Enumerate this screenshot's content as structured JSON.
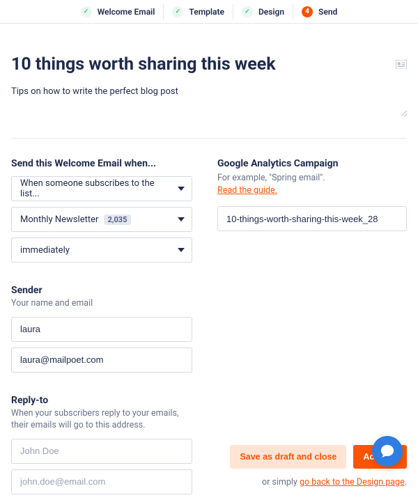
{
  "stepper": {
    "steps": [
      {
        "label": "Welcome Email",
        "badge": "✓",
        "state": "done"
      },
      {
        "label": "Template",
        "badge": "✓",
        "state": "done"
      },
      {
        "label": "Design",
        "badge": "✓",
        "state": "done"
      },
      {
        "label": "Send",
        "badge": "4",
        "state": "current"
      }
    ]
  },
  "header": {
    "title": "10 things worth sharing this week",
    "subject": "Tips on how to write the perfect blog post"
  },
  "trigger": {
    "heading": "Send this Welcome Email when...",
    "event_select": "When someone subscribes to the list...",
    "list_select_label": "Monthly Newsletter",
    "list_select_count": "2,035",
    "delay_select": "immediately"
  },
  "ga": {
    "heading": "Google Analytics Campaign",
    "hint": "For example, \"Spring email\".",
    "guide_link": "Read the guide.",
    "value": "10-things-worth-sharing-this-week_28"
  },
  "sender": {
    "heading": "Sender",
    "hint": "Your name and email",
    "name_value": "laura",
    "email_value": "laura@mailpoet.com"
  },
  "reply_to": {
    "heading": "Reply-to",
    "hint": "When your subscribers reply to your emails, their emails will go to this address.",
    "name_placeholder": "John Doe",
    "email_placeholder": "john.doe@email.com"
  },
  "footer": {
    "save_draft": "Save as draft and close",
    "activate": "Activate",
    "or_text": "or simply ",
    "back_link": "go back to the Design page",
    "period": "."
  }
}
